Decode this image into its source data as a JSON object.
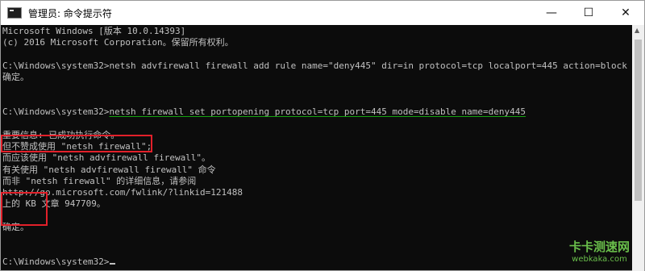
{
  "window": {
    "title": "管理员: 命令提示符"
  },
  "controls": {
    "minimize": "—",
    "maximize": "☐",
    "close": "✕"
  },
  "console": {
    "lines": [
      "Microsoft Windows [版本 10.0.14393]",
      "(c) 2016 Microsoft Corporation。保留所有权利。",
      "",
      "C:\\Windows\\system32>netsh advfirewall firewall add rule name=\"deny445\" dir=in protocol=tcp localport=445 action=block",
      "确定。",
      "",
      "",
      "C:\\Windows\\system32>",
      "",
      "重要信息: 已成功执行命令。",
      "但不赞成使用 \"netsh firewall\";",
      "而应该使用 \"netsh advfirewall firewall\"。",
      "有关使用 \"netsh advfirewall firewall\" 命令",
      "而非 \"netsh firewall\" 的详细信息，请参阅",
      "http://go.microsoft.com/fwlink/?linkid=121488",
      "上的 KB 文章 947709。",
      "",
      "确定。",
      "",
      "",
      "C:\\Windows\\system32>"
    ],
    "cmd2": "netsh firewall set portopening protocol=tcp port=445 mode=disable name=deny445"
  },
  "watermark": {
    "top": "卡卡测速网",
    "bottom": "webkaka.com"
  },
  "colors": {
    "background": "#0c0c0c",
    "text": "#c0c0c0",
    "highlight": "#e2202a",
    "underline": "#13a10e"
  }
}
